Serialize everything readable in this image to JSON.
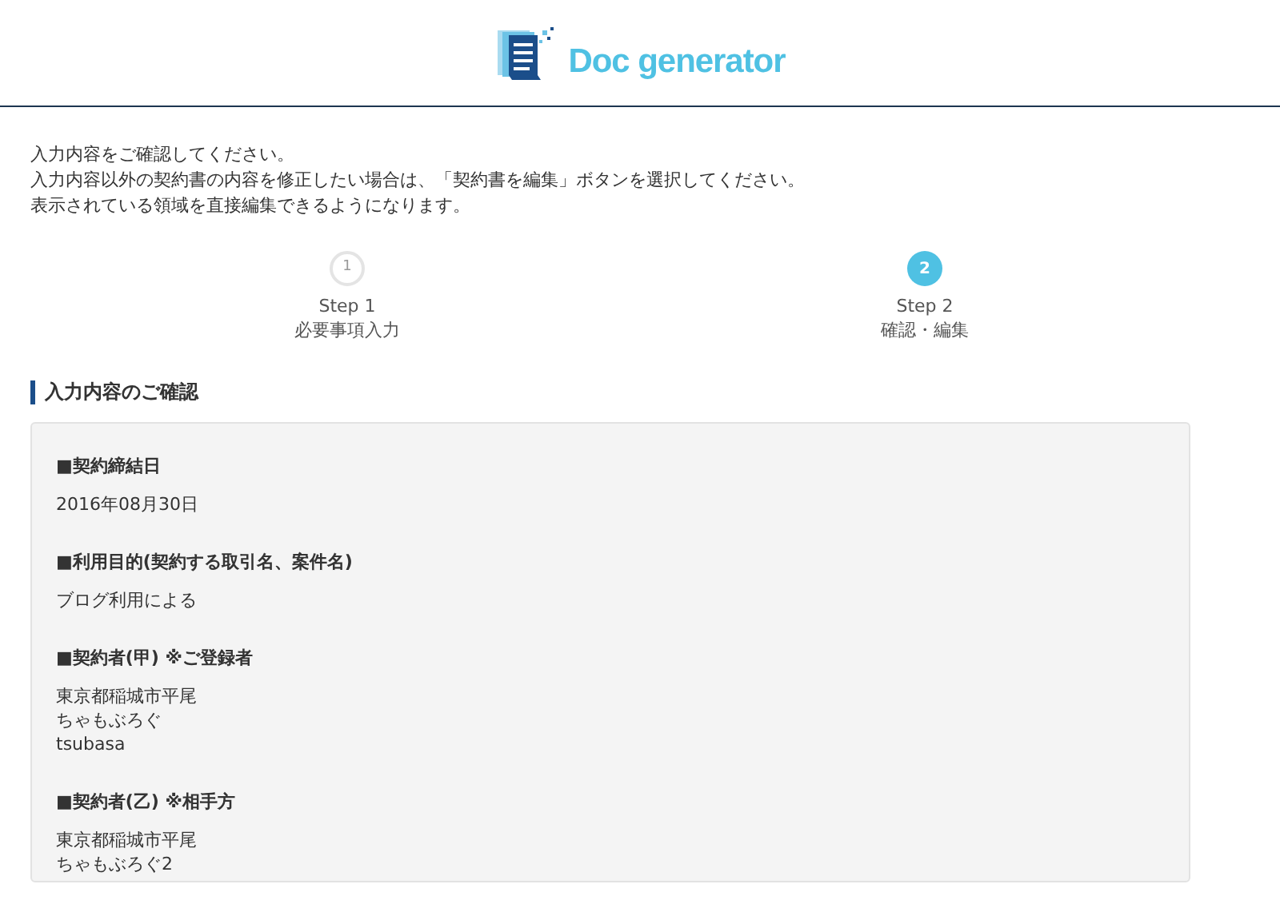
{
  "header": {
    "logo_text": "Doc generator"
  },
  "intro": [
    "入力内容をご確認してください。",
    "入力内容以外の契約書の内容を修正したい場合は、「契約書を編集」ボタンを選択してください。",
    "表示されている領域を直接編集できるようになります。"
  ],
  "steps": [
    {
      "number": "1",
      "label": "Step 1",
      "caption": "必要事項入力",
      "selected": false
    },
    {
      "number": "2",
      "label": "Step 2",
      "caption": "確認・編集",
      "selected": true
    }
  ],
  "section": {
    "title": "入力内容のご確認",
    "fields": [
      {
        "label": "■契約締結日",
        "lines": [
          "2016年08月30日"
        ]
      },
      {
        "label": "■利用目的(契約する取引名、案件名)",
        "lines": [
          "ブログ利用による"
        ]
      },
      {
        "label": "■契約者(甲) ※ご登録者",
        "lines": [
          "東京都稲城市平尾",
          "ちゃもぶろぐ",
          "tsubasa"
        ]
      },
      {
        "label": "■契約者(乙) ※相手方",
        "lines": [
          "東京都稲城市平尾",
          "ちゃもぶろぐ2"
        ]
      }
    ]
  }
}
